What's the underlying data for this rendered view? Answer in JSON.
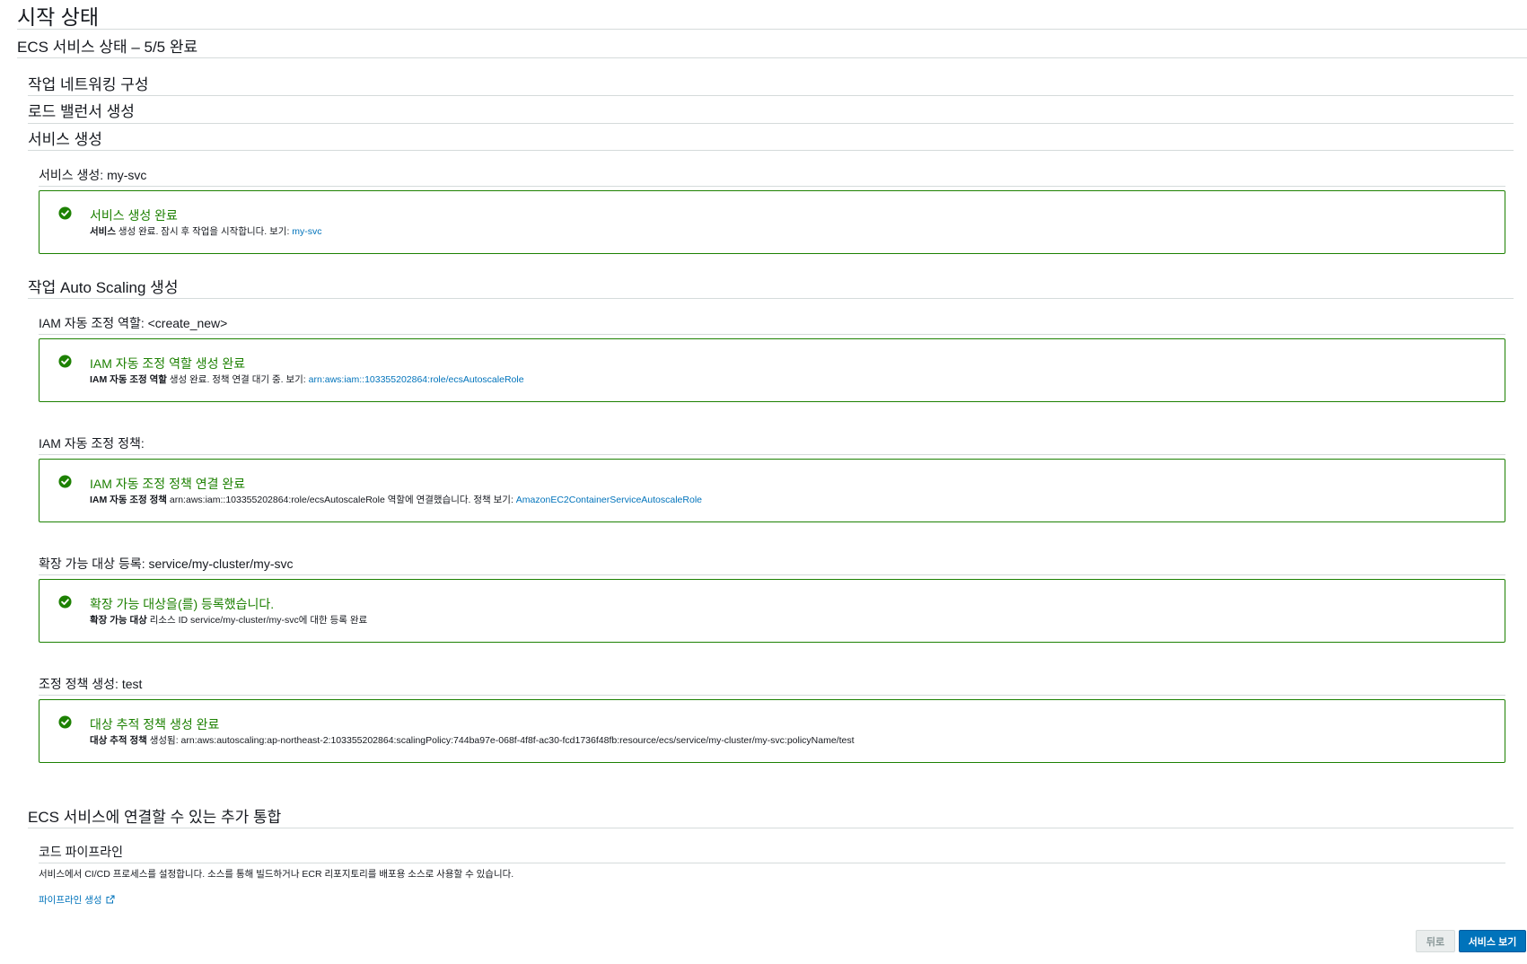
{
  "page": {
    "title": "시작 상태",
    "status_heading": "ECS 서비스 상태 – 5/5 완료"
  },
  "steps": {
    "networking": "작업 네트워킹 구성",
    "load_balancer": "로드 밸런서 생성",
    "service": "서비스 생성",
    "autoscaling": "작업 Auto Scaling 생성",
    "integrations": "ECS 서비스에 연결할 수 있는 추가 통합"
  },
  "service_create": {
    "subheading": "서비스 생성: my-svc",
    "alert_title": "서비스 생성 완료",
    "alert_bold": "서비스",
    "alert_text": " 생성 완료. 잠시 후 작업을 시작합니다. 보기: ",
    "alert_link": "my-svc"
  },
  "iam_role": {
    "subheading": "IAM 자동 조정 역할: <create_new>",
    "alert_title": "IAM 자동 조정 역할 생성 완료",
    "alert_bold": "IAM 자동 조정 역할",
    "alert_text": " 생성 완료. 정책 연결 대기 중. 보기: ",
    "alert_link": "arn:aws:iam::103355202864:role/ecsAutoscaleRole"
  },
  "iam_policy": {
    "subheading": "IAM 자동 조정 정책:",
    "alert_title": "IAM 자동 조정 정책 연결 완료",
    "alert_bold": "IAM 자동 조정 정책",
    "alert_text": " arn:aws:iam::103355202864:role/ecsAutoscaleRole 역할에 연결했습니다. 정책 보기: ",
    "alert_link": "AmazonEC2ContainerServiceAutoscaleRole"
  },
  "scalable_target": {
    "subheading": "확장 가능 대상 등록: service/my-cluster/my-svc",
    "alert_title": "확장 가능 대상을(를) 등록했습니다.",
    "alert_bold": "확장 가능 대상",
    "alert_text": " 리소스 ID service/my-cluster/my-svc에 대한 등록 완료"
  },
  "scaling_policy": {
    "subheading": "조정 정책 생성: test",
    "alert_title": "대상 추적 정책 생성 완료",
    "alert_bold": "대상 추적 정책",
    "alert_text": " 생성됨: arn:aws:autoscaling:ap-northeast-2:103355202864:scalingPolicy:744ba97e-068f-4f8f-ac30-fcd1736f48fb:resource/ecs/service/my-cluster/my-svc:policyName/test"
  },
  "code_pipeline": {
    "subheading": "코드 파이프라인",
    "description": "서비스에서 CI/CD 프로세스를 설정합니다. 소스를 통해 빌드하거나 ECR 리포지토리를 배포용 소스로 사용할 수 있습니다.",
    "link": "파이프라인 생성"
  },
  "buttons": {
    "back": "뒤로",
    "view_service": "서비스 보기"
  },
  "colors": {
    "success": "#1d8102",
    "link": "#0073bb",
    "primary_button": "#0073bb"
  }
}
